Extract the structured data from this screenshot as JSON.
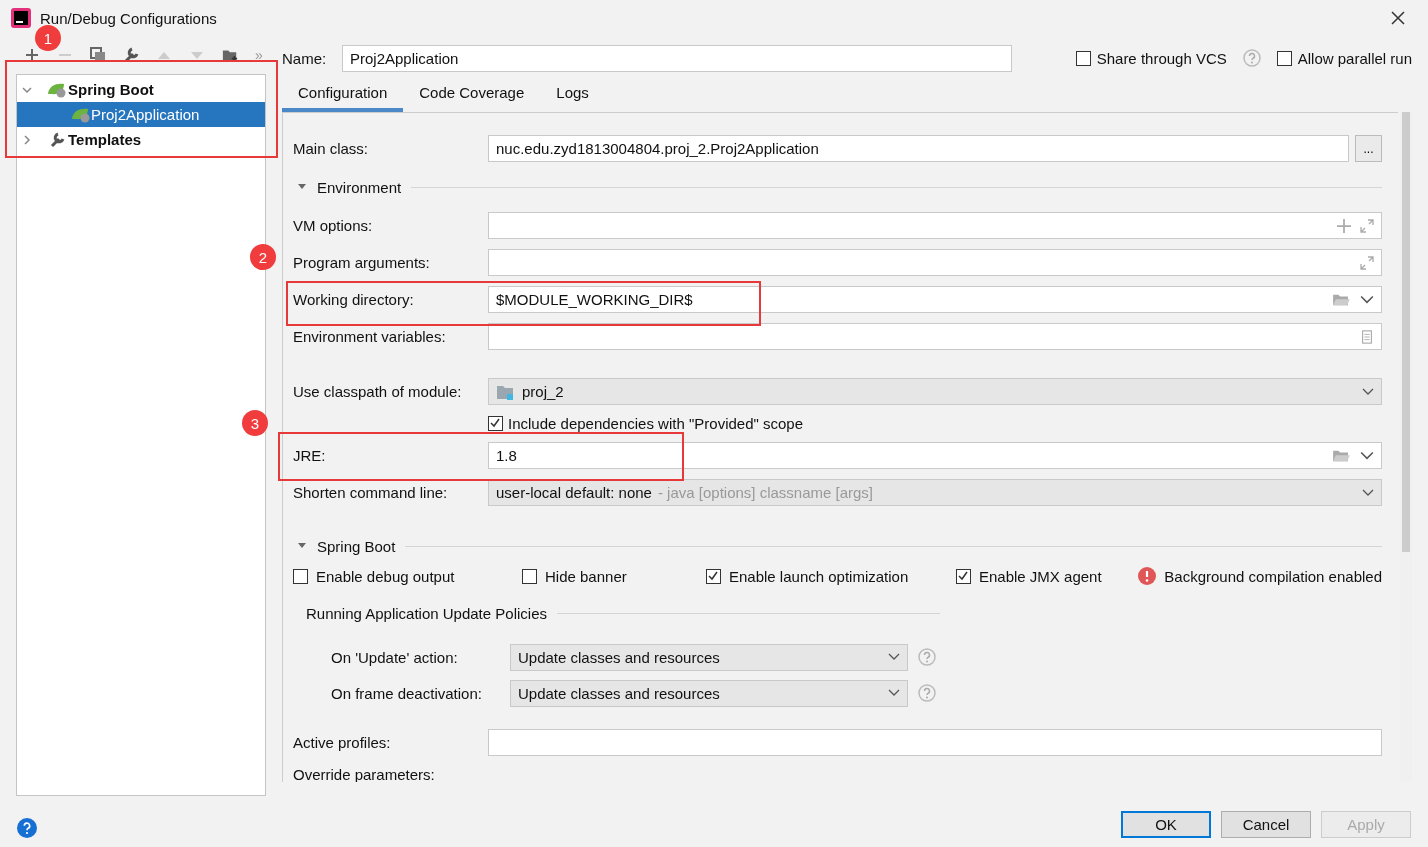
{
  "window": {
    "title": "Run/Debug Configurations"
  },
  "toolbar": {
    "more": "»"
  },
  "tree": [
    {
      "label": "Spring Boot",
      "expanded": true,
      "children": [
        {
          "label": "Proj2Application",
          "selected": true
        }
      ]
    },
    {
      "label": "Templates",
      "expanded": false
    }
  ],
  "name_field": {
    "label": "Name:",
    "value": "Proj2Application"
  },
  "options": [
    {
      "label": "Share through VCS",
      "checked": false,
      "help": true
    },
    {
      "label": "Allow parallel run",
      "checked": false,
      "help": false
    }
  ],
  "tabs": [
    {
      "label": "Configuration",
      "selected": true
    },
    {
      "label": "Code Coverage",
      "selected": false
    },
    {
      "label": "Logs",
      "selected": false
    }
  ],
  "main_class": {
    "label": "Main class:",
    "value": "nuc.edu.zyd1813004804.proj_2.Proj2Application",
    "button": "..."
  },
  "environment": {
    "title": "Environment",
    "expanded": true,
    "fields": [
      {
        "kind": "expand-plus",
        "label": "VM options:"
      },
      {
        "kind": "expand",
        "label": "Program arguments:"
      },
      {
        "kind": "browse",
        "label": "Working directory:",
        "value": "$MODULE_WORKING_DIR$"
      },
      {
        "kind": "document",
        "label": "Environment variables:"
      },
      {
        "kind": "module",
        "label": "Use classpath of module:",
        "value": "proj_2"
      },
      {
        "kind": "checkbox",
        "label": "Include dependencies with \"Provided\" scope",
        "checked": true
      },
      {
        "kind": "browse",
        "label": "JRE:",
        "value": "1.8"
      },
      {
        "kind": "combo",
        "label": "Shorten command line:",
        "value": "user-local default: none",
        "hint": "- java [options] classname [args]"
      }
    ]
  },
  "spring_boot": {
    "title": "Spring Boot",
    "expanded": true,
    "checkboxes": [
      {
        "label": "Enable debug output",
        "checked": false
      },
      {
        "label": "Hide banner",
        "checked": false
      },
      {
        "label": "Enable launch optimization",
        "checked": true
      },
      {
        "label": "Enable JMX agent",
        "checked": true
      }
    ],
    "warning": "Background compilation enabled",
    "policies": {
      "title": "Running Application Update Policies",
      "rows": [
        {
          "label": "On 'Update' action:",
          "value": "Update classes and resources"
        },
        {
          "label": "On frame deactivation:",
          "value": "Update classes and resources"
        }
      ]
    },
    "active_profiles": {
      "label": "Active profiles:"
    },
    "override_parameters": {
      "label": "Override parameters:"
    }
  },
  "buttons": [
    {
      "label": "OK",
      "kind": "default",
      "disabled": false
    },
    {
      "label": "Cancel",
      "kind": "normal",
      "disabled": false
    },
    {
      "label": "Apply",
      "kind": "normal",
      "disabled": true
    }
  ],
  "annotations": [
    {
      "text": "1"
    },
    {
      "text": "2"
    },
    {
      "text": "3"
    }
  ]
}
